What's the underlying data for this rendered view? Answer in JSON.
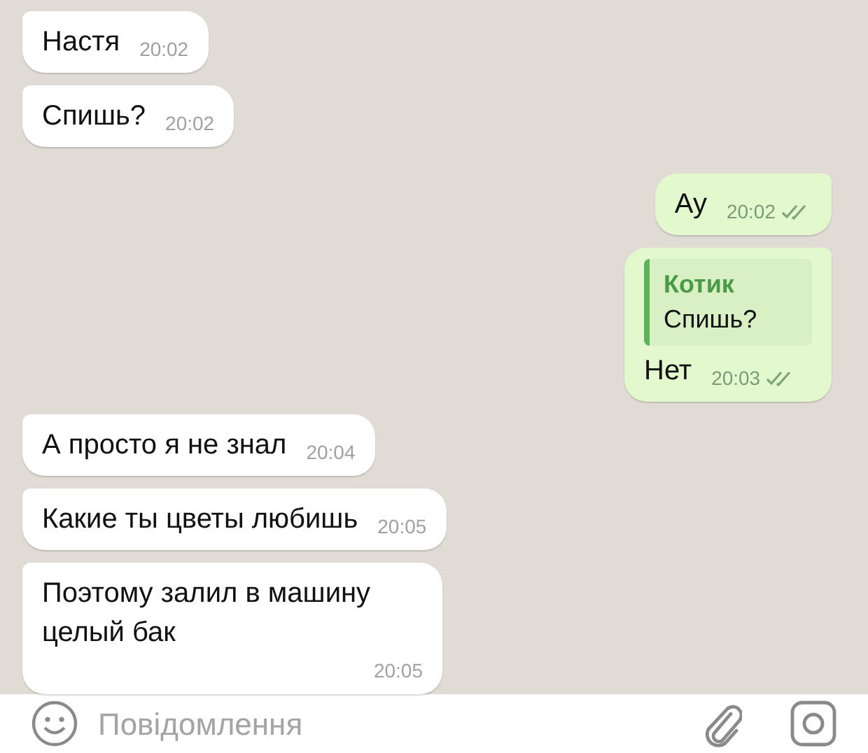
{
  "messages": [
    {
      "kind": "in",
      "text": "Настя",
      "time": "20:02"
    },
    {
      "kind": "in",
      "text": "Спишь?",
      "time": "20:02"
    },
    {
      "kind": "out",
      "text": "Ау",
      "time": "20:02"
    },
    {
      "kind": "out",
      "text": "Нет",
      "time": "20:03",
      "quote": {
        "author": "Котик",
        "text": "Спишь?"
      }
    },
    {
      "kind": "in",
      "text": "А просто я не знал",
      "time": "20:04"
    },
    {
      "kind": "in",
      "text": "Какие ты цветы любишь",
      "time": "20:05"
    },
    {
      "kind": "in",
      "text": "Поэтому залил в машину целый бак",
      "time": "20:05"
    }
  ],
  "composer": {
    "placeholder": "Повідомлення"
  }
}
